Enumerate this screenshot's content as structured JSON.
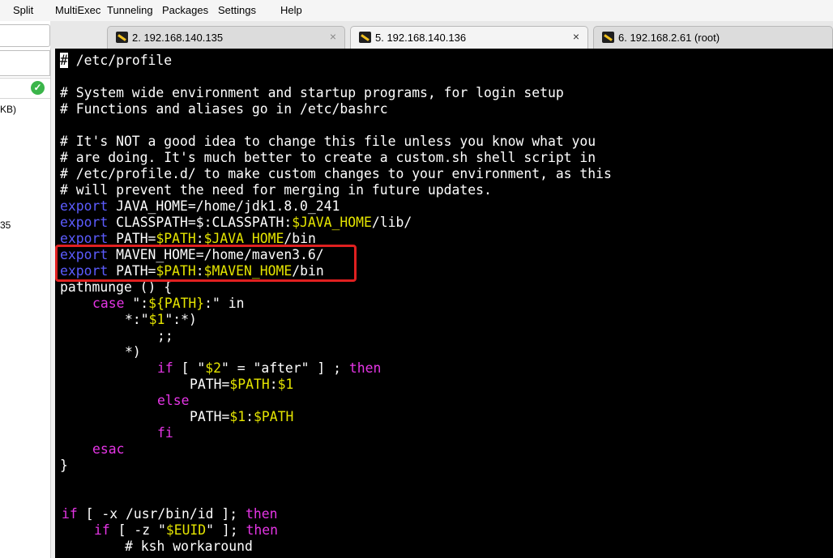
{
  "menu": {
    "split": "Split",
    "multiexec": "MultiExec",
    "tunneling": "Tunneling",
    "packages": "Packages",
    "settings": "Settings",
    "help": "Help"
  },
  "sidebar": {
    "size_fragment": "KB)",
    "ip_fragment": "35"
  },
  "tabs": [
    {
      "label": "2. 192.168.140.135",
      "close": "×"
    },
    {
      "label": "5. 192.168.140.136",
      "close": "×"
    },
    {
      "label": "6. 192.168.2.61 (root)"
    }
  ],
  "terminal": {
    "l01": "/etc/profile",
    "l03": "# System wide environment and startup programs, for login setup",
    "l04": "# Functions and aliases go in /etc/bashrc",
    "l06": "# It's NOT a good idea to change this file unless you know what you",
    "l07": "# are doing. It's much better to create a custom.sh shell script in",
    "l08": "# /etc/profile.d/ to make custom changes to your environment, as this",
    "l09": "# will prevent the need for merging in future updates.",
    "export": "export",
    "java_home_assign": " JAVA_HOME=/home/jdk1.8.0_241",
    "classpath_assign": " CLASSPATH=$:CLASSPATH:",
    "java_home_var": "$JAVA_HOME",
    "lib_suffix": "/lib/",
    "path_assign": " PATH=",
    "path_var": "$PATH",
    "colon": ":",
    "bin_suffix": "/bin",
    "maven_home_assign": " MAVEN_HOME=/home/maven3.6/",
    "maven_home_var": "$MAVEN_HOME",
    "pathmunge": "pathmunge () {",
    "case": "case",
    "case_q1": " \":",
    "path_brace": "${PATH}",
    "case_q2": ":\" in",
    "pat1_a": "*:\"",
    "arg1": "$1",
    "pat1_b": "\":*)",
    "dsemi": ";;",
    "star": "*)",
    "if": "if",
    "test_a": " [ \"",
    "arg2": "$2",
    "test_b": "\" = \"after\" ] ; ",
    "then": "then",
    "path_eq": "PATH=",
    "else": "else",
    "fi": "fi",
    "esac": "esac",
    "rbrace": "}",
    "test_x": " [ -x /usr/bin/id ]; ",
    "test_z_a": " [ -z \"",
    "euid": "$EUID",
    "test_z_b": "\" ]; ",
    "ksh": "# ksh workaround"
  }
}
